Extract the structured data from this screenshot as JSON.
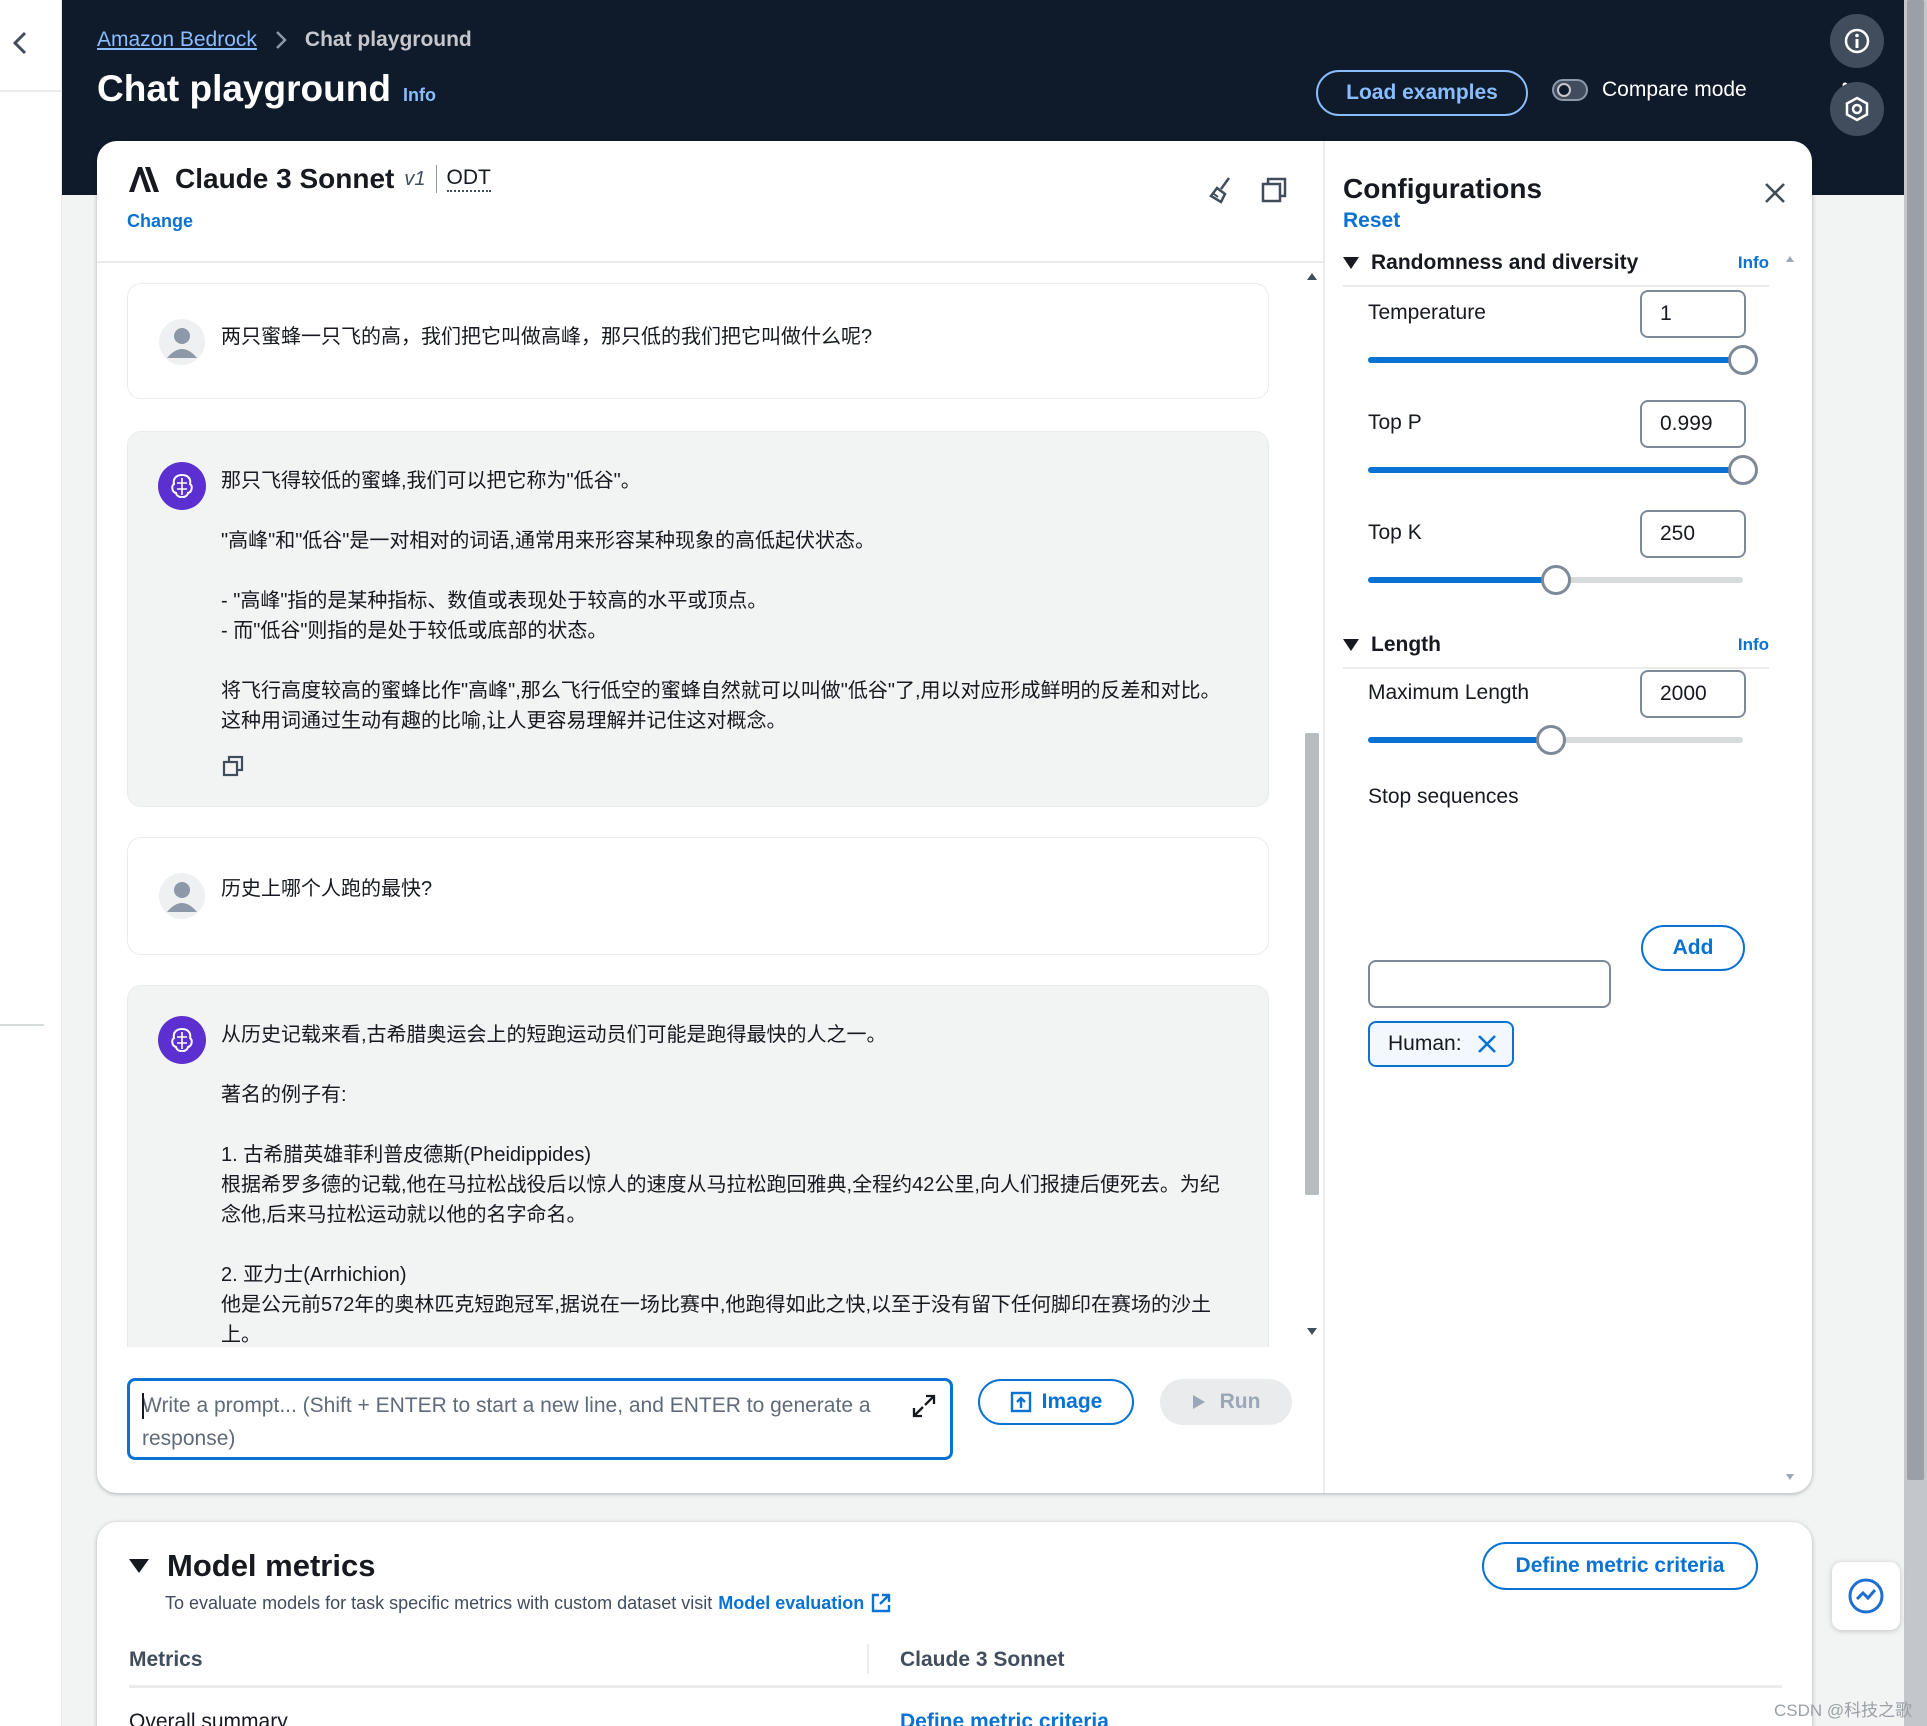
{
  "breadcrumb": {
    "root": "Amazon Bedrock",
    "current": "Chat playground"
  },
  "page": {
    "title": "Chat playground",
    "info": "Info"
  },
  "header_actions": {
    "load_examples": "Load examples",
    "compare_mode": "Compare mode",
    "compare_mode_on": false
  },
  "model": {
    "name": "Claude 3 Sonnet",
    "version": "v1",
    "throughput": "ODT",
    "change": "Change"
  },
  "messages": [
    {
      "role": "user",
      "text": "两只蜜蜂一只飞的高，我们把它叫做高峰，那只低的我们把它叫做什么呢?"
    },
    {
      "role": "assistant",
      "text": "那只飞得较低的蜜蜂,我们可以把它称为\"低谷\"。\n\n\"高峰\"和\"低谷\"是一对相对的词语,通常用来形容某种现象的高低起伏状态。\n\n- \"高峰\"指的是某种指标、数值或表现处于较高的水平或顶点。\n- 而\"低谷\"则指的是处于较低或底部的状态。\n\n将飞行高度较高的蜜蜂比作\"高峰\",那么飞行低空的蜜蜂自然就可以叫做\"低谷\"了,用以对应形成鲜明的反差和对比。这种用词通过生动有趣的比喻,让人更容易理解并记住这对概念。"
    },
    {
      "role": "user",
      "text": "历史上哪个人跑的最快?"
    },
    {
      "role": "assistant",
      "text": "从历史记载来看,古希腊奥运会上的短跑运动员们可能是跑得最快的人之一。\n\n著名的例子有:\n\n1. 古希腊英雄菲利普皮德斯(Pheidippides)\n根据希罗多德的记载,他在马拉松战役后以惊人的速度从马拉松跑回雅典,全程约42公里,向人们报捷后便死去。为纪念他,后来马拉松运动就以他的名字命名。\n\n2. 亚力士(Arrhichion)\n他是公元前572年的奥林匹克短跑冠军,据说在一场比赛中,他跑得如此之快,以至于没有留下任何脚印在赛场的沙土上。"
    }
  ],
  "prompt": {
    "placeholder": "Write a prompt... (Shift + ENTER to start a new line, and ENTER to generate a response)",
    "value": ""
  },
  "actions": {
    "image": "Image",
    "run": "Run"
  },
  "config": {
    "title": "Configurations",
    "reset": "Reset",
    "randomness": {
      "label": "Randomness and diversity",
      "info": "Info",
      "temperature": {
        "label": "Temperature",
        "value": "1",
        "min": 0,
        "max": 1
      },
      "top_p": {
        "label": "Top P",
        "value": "0.999",
        "min": 0,
        "max": 1
      },
      "top_k": {
        "label": "Top K",
        "value": "250",
        "min": 0,
        "max": 500
      }
    },
    "length": {
      "label": "Length",
      "info": "Info",
      "max_length": {
        "label": "Maximum Length",
        "value": "2000",
        "min": 0,
        "max": 4096
      },
      "stop_sequences": {
        "label": "Stop sequences",
        "add": "Add",
        "input_value": "",
        "tokens": [
          "Human:"
        ]
      }
    }
  },
  "metrics": {
    "title": "Model metrics",
    "description": "To evaluate models for task specific metrics with custom dataset visit",
    "eval_link": "Model evaluation",
    "define_button": "Define metric criteria",
    "columns": [
      "Metrics",
      "Claude 3 Sonnet"
    ],
    "rows": [
      {
        "metric": "Overall summary",
        "value": "Define metric criteria"
      }
    ]
  },
  "watermark": "CSDN @科技之歌",
  "colors": {
    "header_bg": "#0f1b2a",
    "accent": "#0972d3",
    "link_dark": "#89bdff",
    "ai_avatar": "#5b2fd0"
  }
}
